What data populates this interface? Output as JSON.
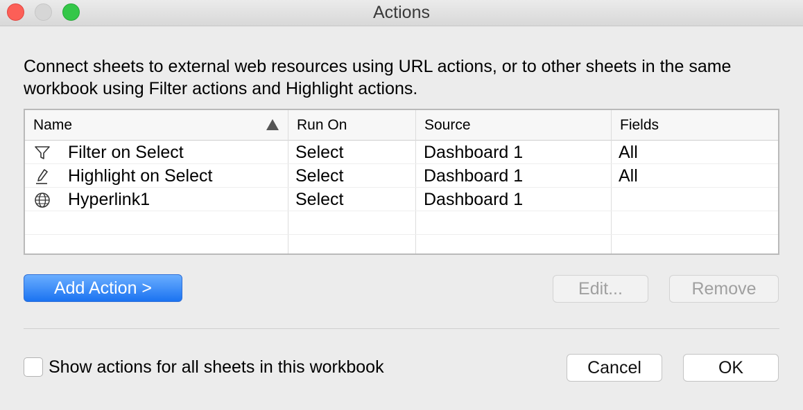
{
  "window": {
    "title": "Actions"
  },
  "description": "Connect sheets to external web resources using URL actions, or to other sheets in the same workbook using Filter actions and Highlight actions.",
  "table": {
    "columns": [
      "Name",
      "Run On",
      "Source",
      "Fields"
    ],
    "sort_column": "Name",
    "rows": [
      {
        "icon": "filter-icon",
        "name": "Filter on Select",
        "run_on": "Select",
        "source": "Dashboard 1",
        "fields": "All"
      },
      {
        "icon": "highlighter-icon",
        "name": "Highlight on Select",
        "run_on": "Select",
        "source": "Dashboard 1",
        "fields": "All"
      },
      {
        "icon": "globe-icon",
        "name": "Hyperlink1",
        "run_on": "Select",
        "source": "Dashboard 1",
        "fields": ""
      }
    ]
  },
  "buttons": {
    "add_action": "Add Action >",
    "edit": "Edit...",
    "remove": "Remove",
    "cancel": "Cancel",
    "ok": "OK"
  },
  "show_all": {
    "label": "Show actions for all sheets in this workbook",
    "checked": false
  },
  "colors": {
    "accent": "#1b73f1"
  }
}
